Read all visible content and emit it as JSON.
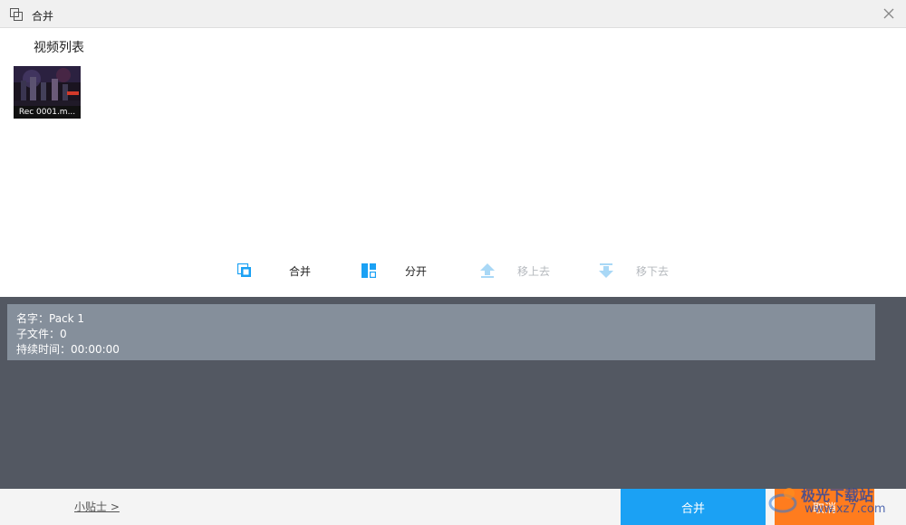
{
  "window": {
    "title": "合并"
  },
  "video_list": {
    "title": "视频列表",
    "items": [
      {
        "name": "Rec 0001.m..."
      }
    ]
  },
  "toolbar": {
    "merge_label": "合并",
    "split_label": "分开",
    "move_up_label": "移上去",
    "move_down_label": "移下去"
  },
  "info": {
    "name_line": "名字：Pack 1",
    "files_line": "子文件：0",
    "duration_line": "持续时间：00:00:00"
  },
  "footer": {
    "tips_label": "小贴士 >",
    "merge_button_label": "合并",
    "cancel_button_label": "取消"
  },
  "watermark": {
    "line1": "极光下载站",
    "line2": "www.xz7.com"
  },
  "colors": {
    "accent_blue": "#1ba1f4",
    "cancel_orange": "#ff7c1e",
    "info_panel_bg": "#535862",
    "info_card_bg": "#858f9b"
  }
}
